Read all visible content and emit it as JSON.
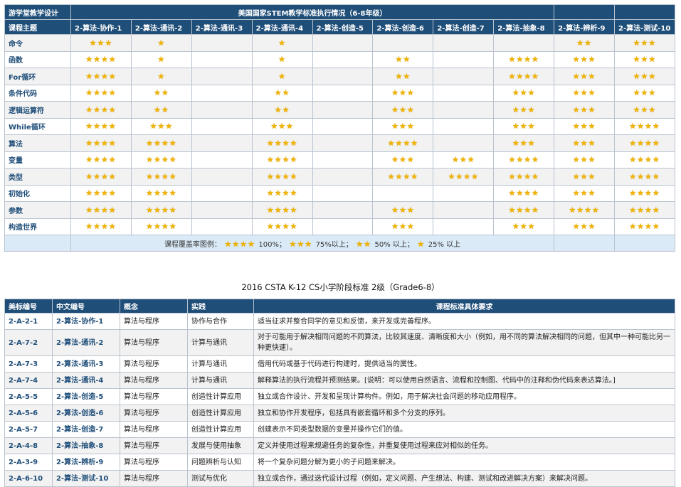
{
  "top_table": {
    "corner_label": "游学堂教学设计",
    "title": "美国国家STEM教学标准执行情况（6-8年级）",
    "topic_header": "课程主题",
    "columns": [
      "2-算法-协作-1",
      "2-算法-通讯-2",
      "2-算法-通讯-3",
      "2-算法-通讯-4",
      "2-算法-创造-5",
      "2-算法-创造-6",
      "2-算法-创造-7",
      "2-算法-抽象-8",
      "2-算法-辨析-9",
      "2-算法-测试-10"
    ],
    "rows": [
      {
        "topic": "命令",
        "cells": [
          3,
          1,
          0,
          1,
          0,
          0,
          0,
          0,
          2,
          3
        ]
      },
      {
        "topic": "函数",
        "cells": [
          4,
          1,
          0,
          1,
          0,
          2,
          0,
          4,
          3,
          3
        ]
      },
      {
        "topic": "For循环",
        "cells": [
          4,
          1,
          0,
          1,
          0,
          2,
          0,
          4,
          3,
          3
        ]
      },
      {
        "topic": "条件代码",
        "cells": [
          4,
          2,
          0,
          2,
          0,
          3,
          0,
          3,
          3,
          3
        ]
      },
      {
        "topic": "逻辑运算符",
        "cells": [
          4,
          2,
          0,
          2,
          0,
          3,
          0,
          3,
          3,
          3
        ]
      },
      {
        "topic": "While循环",
        "cells": [
          4,
          3,
          0,
          3,
          0,
          3,
          0,
          3,
          3,
          4
        ]
      },
      {
        "topic": "算法",
        "cells": [
          4,
          4,
          0,
          4,
          0,
          4,
          0,
          3,
          3,
          4
        ]
      },
      {
        "topic": "变量",
        "cells": [
          4,
          4,
          0,
          4,
          0,
          3,
          3,
          4,
          3,
          4
        ]
      },
      {
        "topic": "类型",
        "cells": [
          4,
          4,
          0,
          4,
          0,
          4,
          4,
          4,
          3,
          4
        ]
      },
      {
        "topic": "初始化",
        "cells": [
          4,
          4,
          0,
          4,
          0,
          0,
          0,
          4,
          3,
          4
        ]
      },
      {
        "topic": "参数",
        "cells": [
          4,
          4,
          0,
          4,
          0,
          3,
          0,
          4,
          4,
          4
        ]
      },
      {
        "topic": "构造世界",
        "cells": [
          4,
          4,
          0,
          4,
          0,
          3,
          0,
          3,
          3,
          4
        ]
      }
    ],
    "legend_prefix": "课程覆盖率图例：",
    "legend_items": [
      {
        "stars": 4,
        "text": "100%；"
      },
      {
        "stars": 3,
        "text": "75%以上；"
      },
      {
        "stars": 2,
        "text": "50% 以上；"
      },
      {
        "stars": 1,
        "text": "25% 以上"
      }
    ],
    "star_color": "#f0b400",
    "header_color": "#1f4e79"
  },
  "middle_title": "2016 CSTA K-12 CS小学阶段标准 2级（Grade6-8）",
  "bottom_table": {
    "headers": [
      "美标编号",
      "中文编号",
      "概念",
      "实践",
      "课程标准具体要求"
    ],
    "rows": [
      {
        "id": "2-A-2-1",
        "cn": "2-算法-协作-1",
        "concept": "算法与程序",
        "practice": "协作与合作",
        "req": "适当征求并整合同学的意见和反馈，来开发或完善程序。"
      },
      {
        "id": "2-A-7-2",
        "cn": "2-算法-通讯-2",
        "concept": "算法与程序",
        "practice": "计算与通讯",
        "req": "对于可能用于解决相同问题的不同算法，比较其速度、清晰度和大小（例如，用不同的算法解决相同的问题，但其中一种可能比另一种更快速）。"
      },
      {
        "id": "2-A-7-3",
        "cn": "2-算法-通讯-3",
        "concept": "算法与程序",
        "practice": "计算与通讯",
        "req": "借用代码或基于代码进行构建时，提供适当的属性。"
      },
      {
        "id": "2-A-7-4",
        "cn": "2-算法-通讯-4",
        "concept": "算法与程序",
        "practice": "计算与通讯",
        "req": "解释算法的执行流程并预测结果。[说明：可以使用自然语言、流程和控制图、代码中的注释和伪代码来表达算法。]"
      },
      {
        "id": "2-A-5-5",
        "cn": "2-算法-创造-5",
        "concept": "算法与程序",
        "practice": "创造性计算应用",
        "req": "独立或合作设计、开发和呈现计算构件。例如，用于解决社会问题的移动应用程序。"
      },
      {
        "id": "2-A-5-6",
        "cn": "2-算法-创造-6",
        "concept": "算法与程序",
        "practice": "创造性计算应用",
        "req": "独立和协作开发程序，包括具有嵌套循环和多个分支的序列。"
      },
      {
        "id": "2-A-5-7",
        "cn": "2-算法-创造-7",
        "concept": "算法与程序",
        "practice": "创造性计算应用",
        "req": "创建表示不同类型数据的变量并操作它们的值。"
      },
      {
        "id": "2-A-4-8",
        "cn": "2-算法-抽象-8",
        "concept": "算法与程序",
        "practice": "发展与使用抽象",
        "req": "定义并使用过程来规避任务的复杂性，并重复使用过程来应对相似的任务。"
      },
      {
        "id": "2-A-3-9",
        "cn": "2-算法-辨析-9",
        "concept": "算法与程序",
        "practice": "问题辨析与认知",
        "req": "将一个复杂问题分解为更小的子问题来解决。"
      },
      {
        "id": "2-A-6-10",
        "cn": "2-算法-测试-10",
        "concept": "算法与程序",
        "practice": "测试与优化",
        "req": "独立或合作，通过迭代设计过程（例如，定义问题、产生想法、构建、测试和改进解决方案）来解决问题。"
      }
    ]
  }
}
